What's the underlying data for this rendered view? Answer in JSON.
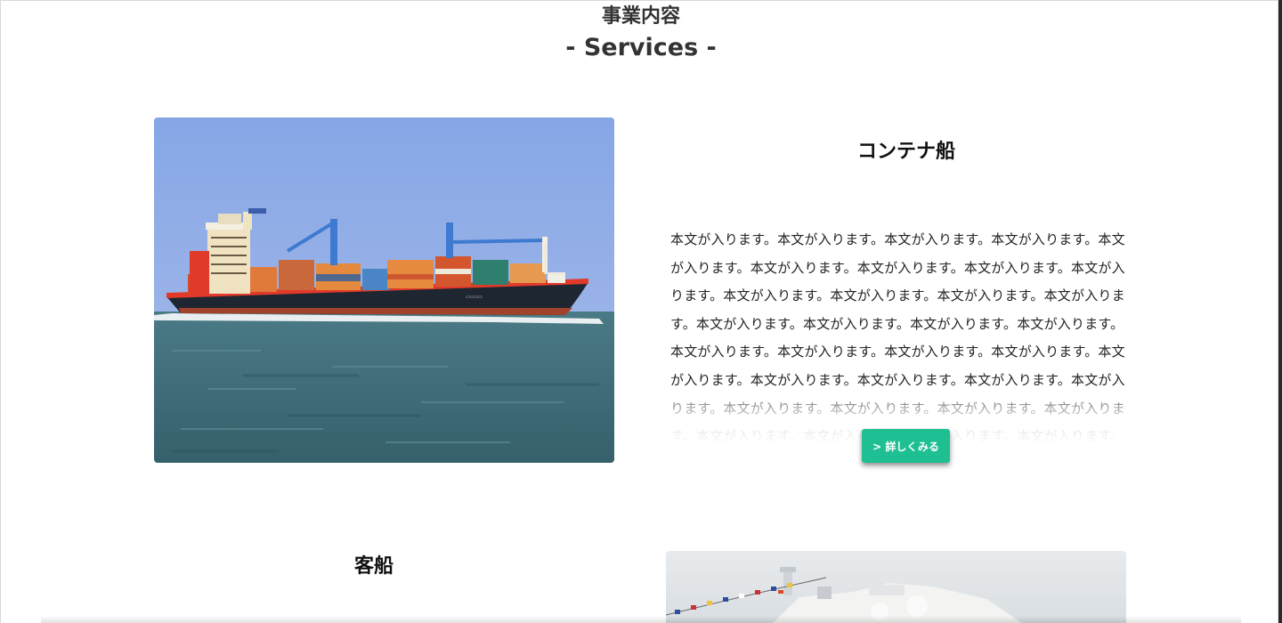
{
  "section": {
    "title_ja": "事業内容",
    "title_en": "- Services -"
  },
  "services": [
    {
      "title": "コンテナ船",
      "body": "本文が入ります。本文が入ります。本文が入ります。本文が入ります。本文が入ります。本文が入ります。本文が入ります。本文が入ります。本文が入ります。本文が入ります。本文が入ります。本文が入ります。本文が入ります。本文が入ります。本文が入ります。本文が入ります。本文が入ります。本文が入ります。本文が入ります。本文が入ります。本文が入ります。本文が入ります。本文が入ります。本文が入ります。本文が入ります。本文が入ります。本文が入ります。本文が入ります。本文が入ります。本文が入ります。本文が入ります。本文が入ります。本文が入ります。本文が入ります。",
      "button_label": "> 詳しくみる",
      "image": "container-ship-photo"
    },
    {
      "title": "客船",
      "image": "passenger-ship-photo"
    }
  ],
  "colors": {
    "button": "#1fbf94",
    "sky": "#8aa8e6",
    "sea": "#3e6c78"
  }
}
